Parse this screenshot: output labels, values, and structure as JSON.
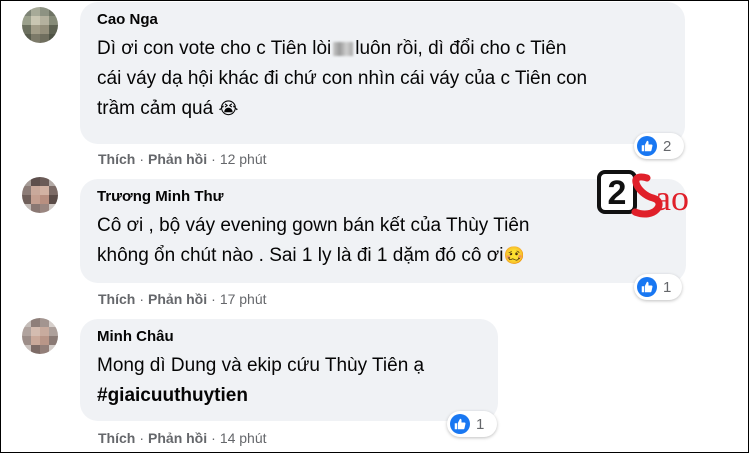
{
  "comments": [
    {
      "author": "Cao Nga",
      "lines": [
        "Dì ơi con vote cho c Tiên lòi",
        "luôn rồi, dì đổi cho c Tiên",
        "cái váy dạ hội khác đi chứ con nhìn cái váy của c Tiên con",
        "trầm cảm quá"
      ],
      "emoji": "😭",
      "actions": {
        "like": "Thích",
        "reply": "Phản hồi",
        "time": "12 phút"
      },
      "reaction_count": "2"
    },
    {
      "author": "Trương Minh Thư",
      "lines": [
        "Cô ơi , bộ váy evening gown bán kết của Thùy Tiên",
        "không ổn chút nào . Sai 1 ly là đi 1 dặm đó cô ơi"
      ],
      "emoji": "🥴",
      "actions": {
        "like": "Thích",
        "reply": "Phản hồi",
        "time": "17 phút"
      },
      "reaction_count": "1"
    },
    {
      "author": "Minh Châu",
      "lines": [
        "Mong dì Dung và ekip cứu Thùy Tiên ạ"
      ],
      "hashtag": "#giaicuuthuytien",
      "actions": {
        "like": "Thích",
        "reply": "Phản hồi",
        "time": "14 phút"
      },
      "reaction_count": "1"
    }
  ],
  "watermark": {
    "number": "2",
    "word": "Sao"
  },
  "colors": {
    "like_blue": "#1877f2",
    "logo_red": "#e0202a",
    "bubble": "#f0f2f5",
    "meta_gray": "#65676b"
  },
  "icons": [
    "like-icon",
    "avatar"
  ]
}
